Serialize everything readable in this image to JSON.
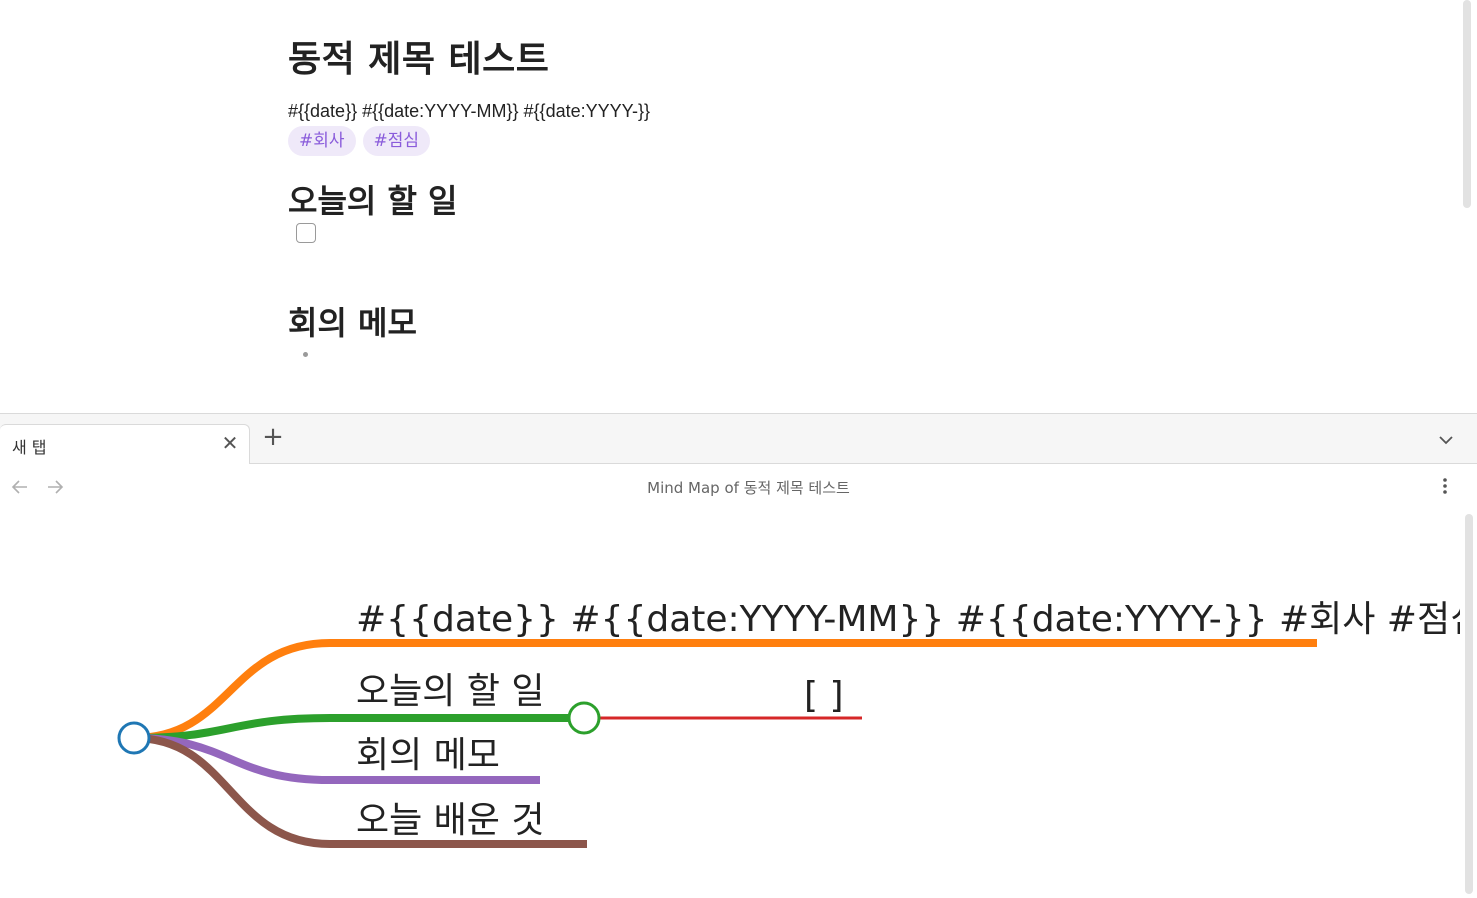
{
  "note": {
    "title": "동적 제목 테스트",
    "meta_line": "#{{date}} #{{date:YYYY-MM}} #{{date:YYYY-}}",
    "tags": [
      "#회사",
      "#점심"
    ],
    "section_todo": "오늘의 할 일",
    "section_memo": "회의 메모"
  },
  "tabs": {
    "active_label": "새 탭",
    "close_icon": "close-icon",
    "new_tab_icon": "plus-icon",
    "list_icon": "chevron-down-icon"
  },
  "view": {
    "title": "Mind Map of 동적 제목 테스트",
    "back_icon": "arrow-left-icon",
    "forward_icon": "arrow-right-icon",
    "more_icon": "more-vertical-icon"
  },
  "mindmap": {
    "branches": [
      {
        "label": "#{{date}} #{{date:YYYY-MM}} #{{date:YYYY-}} #회사 #점심",
        "color": "#ff7f0e"
      },
      {
        "label": "오늘의 할 일",
        "color": "#2ca02c",
        "children": [
          {
            "label": "[ ]",
            "color": "#d62728"
          }
        ]
      },
      {
        "label": "회의 메모",
        "color": "#9467bd"
      },
      {
        "label": "오늘 배운 것",
        "color": "#8c564b"
      }
    ],
    "root_color": "#1f77b4"
  }
}
